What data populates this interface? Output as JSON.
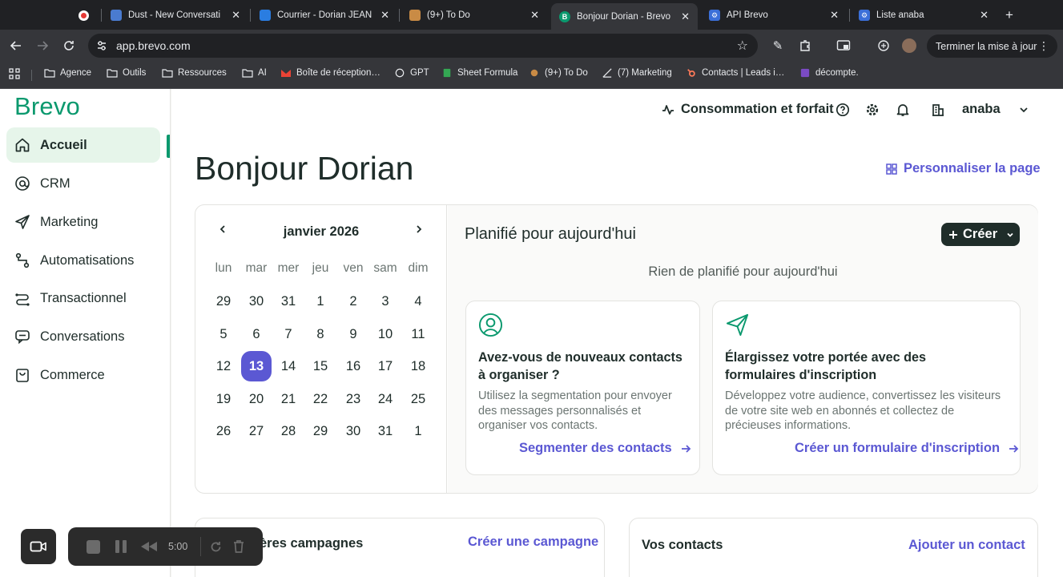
{
  "browser": {
    "tabs": [
      {
        "title": "",
        "favicon": "record-favicon",
        "active": false
      },
      {
        "title": "Dust - New Conversati",
        "favicon": "dust-favicon",
        "active": false
      },
      {
        "title": "Courrier - Dorian JEAN",
        "favicon": "outlook-favicon",
        "active": false
      },
      {
        "title": "(9+) To Do",
        "favicon": "todo-favicon",
        "active": false
      },
      {
        "title": "Bonjour Dorian - Brevo",
        "favicon": "brevo-favicon",
        "active": true
      },
      {
        "title": "API Brevo",
        "favicon": "gear-favicon",
        "active": false
      },
      {
        "title": "Liste anaba",
        "favicon": "gear-favicon",
        "active": false
      }
    ],
    "url": "app.brevo.com",
    "update_button": "Terminer la mise à jour",
    "bookmarks": [
      {
        "label": "Agence",
        "icon": "folder-icon"
      },
      {
        "label": "Outils",
        "icon": "folder-icon"
      },
      {
        "label": "Ressources",
        "icon": "folder-icon"
      },
      {
        "label": "AI",
        "icon": "folder-icon"
      },
      {
        "label": "Boîte de réception…",
        "icon": "gmail-icon"
      },
      {
        "label": "GPT",
        "icon": "openai-icon"
      },
      {
        "label": "Sheet Formula",
        "icon": "sheet-icon"
      },
      {
        "label": "(9+) To Do",
        "icon": "todo-icon"
      },
      {
        "label": "(7) Marketing",
        "icon": "chart-icon"
      },
      {
        "label": "Contacts | Leads i…",
        "icon": "hubspot-icon"
      },
      {
        "label": "décompte.",
        "icon": "notion-icon"
      }
    ]
  },
  "app": {
    "logo": "Brevo",
    "nav": [
      {
        "label": "Accueil",
        "icon": "home-icon",
        "active": true
      },
      {
        "label": "CRM",
        "icon": "at-icon",
        "active": false
      },
      {
        "label": "Marketing",
        "icon": "send-icon",
        "active": false
      },
      {
        "label": "Automatisations",
        "icon": "automation-icon",
        "active": false
      },
      {
        "label": "Transactionnel",
        "icon": "transactional-icon",
        "active": false
      },
      {
        "label": "Conversations",
        "icon": "chat-icon",
        "active": false
      },
      {
        "label": "Commerce",
        "icon": "bag-icon",
        "active": false
      }
    ],
    "topbar": {
      "plan": "Consommation et forfait",
      "account": "anaba"
    },
    "greeting": "Bonjour Dorian",
    "personalize": "Personnaliser la page",
    "calendar": {
      "month": "janvier 2026",
      "weekdays": [
        "lun",
        "mar",
        "mer",
        "jeu",
        "ven",
        "sam",
        "dim"
      ],
      "weeks": [
        [
          "29",
          "30",
          "31",
          "1",
          "2",
          "3",
          "4"
        ],
        [
          "5",
          "6",
          "7",
          "8",
          "9",
          "10",
          "11"
        ],
        [
          "12",
          "13",
          "14",
          "15",
          "16",
          "17",
          "18"
        ],
        [
          "19",
          "20",
          "21",
          "22",
          "23",
          "24",
          "25"
        ],
        [
          "26",
          "27",
          "28",
          "29",
          "30",
          "31",
          "1"
        ]
      ],
      "today": "13"
    },
    "planned": {
      "title": "Planifié pour aujourd'hui",
      "create_label": "Créer",
      "empty_text": "Rien de planifié pour aujourd'hui"
    },
    "cards": [
      {
        "title": "Avez-vous de nouveaux contacts à organiser ?",
        "body": "Utilisez la segmentation pour envoyer des messages personnalisés et organiser vos contacts.",
        "link": "Segmenter des contacts",
        "icon": "user-circle-icon"
      },
      {
        "title": "Élargissez votre portée avec des formulaires d'inscription",
        "body": "Développez votre audience, convertissez les visiteurs de votre site web en abonnés et collectez de précieuses informations.",
        "link": "Créer un formulaire d'inscription",
        "icon": "send-icon"
      }
    ],
    "campaigns": {
      "title": "Dernières campagnes",
      "visible_title": "ères campagnes",
      "link": "Créer une campagne"
    },
    "contacts": {
      "title": "Vos contacts",
      "link": "Ajouter un contact"
    },
    "colors": {
      "brand_green": "#0b996e",
      "accent": "#5b58d3",
      "dark": "#1f2d2a"
    }
  },
  "recorder": {
    "time": "5:00"
  }
}
